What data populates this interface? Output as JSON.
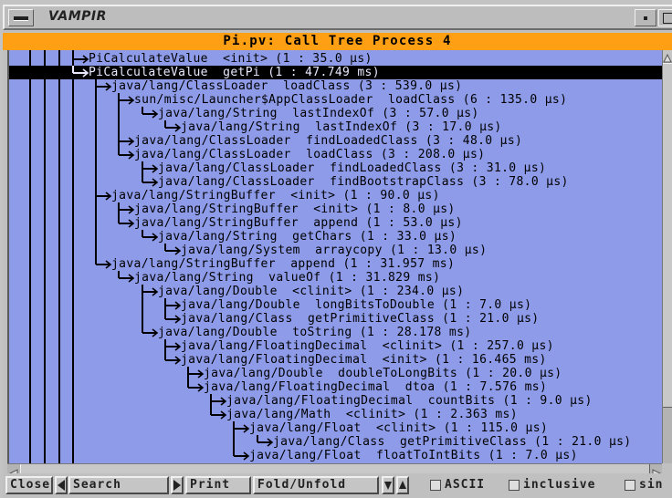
{
  "window": {
    "title": "VAMPIR",
    "colors": {
      "header": "#ff9f14",
      "tree_bg": "#8d9be9",
      "selection": "#000000"
    }
  },
  "tree": {
    "header": "Pi.pv: Call Tree Process 4",
    "rows": [
      {
        "level": 0,
        "text": "PiCalculateValue  <init> (1 : 35.0 µs)",
        "selected": false
      },
      {
        "level": 0,
        "text": "PiCalculateValue  getPi (1 : 47.749 ms)",
        "selected": true
      },
      {
        "level": 1,
        "text": "java/lang/ClassLoader  loadClass (3 : 539.0 µs)",
        "selected": false
      },
      {
        "level": 2,
        "text": "sun/misc/Launcher$AppClassLoader  loadClass (6 : 135.0 µs)",
        "selected": false
      },
      {
        "level": 3,
        "text": "java/lang/String  lastIndexOf (3 : 57.0 µs)",
        "selected": false
      },
      {
        "level": 4,
        "text": "java/lang/String  lastIndexOf (3 : 17.0 µs)",
        "selected": false
      },
      {
        "level": 2,
        "text": "java/lang/ClassLoader  findLoadedClass (3 : 48.0 µs)",
        "selected": false
      },
      {
        "level": 2,
        "text": "java/lang/ClassLoader  loadClass (3 : 208.0 µs)",
        "selected": false
      },
      {
        "level": 3,
        "text": "java/lang/ClassLoader  findLoadedClass (3 : 31.0 µs)",
        "selected": false
      },
      {
        "level": 3,
        "text": "java/lang/ClassLoader  findBootstrapClass (3 : 78.0 µs)",
        "selected": false
      },
      {
        "level": 1,
        "text": "java/lang/StringBuffer  <init> (1 : 90.0 µs)",
        "selected": false
      },
      {
        "level": 2,
        "text": "java/lang/StringBuffer  <init> (1 : 8.0 µs)",
        "selected": false
      },
      {
        "level": 2,
        "text": "java/lang/StringBuffer  append (1 : 53.0 µs)",
        "selected": false
      },
      {
        "level": 3,
        "text": "java/lang/String  getChars (1 : 33.0 µs)",
        "selected": false
      },
      {
        "level": 4,
        "text": "java/lang/System  arraycopy (1 : 13.0 µs)",
        "selected": false
      },
      {
        "level": 1,
        "text": "java/lang/StringBuffer  append (1 : 31.957 ms)",
        "selected": false
      },
      {
        "level": 2,
        "text": "java/lang/String  valueOf (1 : 31.829 ms)",
        "selected": false
      },
      {
        "level": 3,
        "text": "java/lang/Double  <clinit> (1 : 234.0 µs)",
        "selected": false
      },
      {
        "level": 4,
        "text": "java/lang/Double  longBitsToDouble (1 : 7.0 µs)",
        "selected": false
      },
      {
        "level": 4,
        "text": "java/lang/Class  getPrimitiveClass (1 : 21.0 µs)",
        "selected": false
      },
      {
        "level": 3,
        "text": "java/lang/Double  toString (1 : 28.178 ms)",
        "selected": false
      },
      {
        "level": 4,
        "text": "java/lang/FloatingDecimal  <clinit> (1 : 257.0 µs)",
        "selected": false
      },
      {
        "level": 4,
        "text": "java/lang/FloatingDecimal  <init> (1 : 16.465 ms)",
        "selected": false
      },
      {
        "level": 5,
        "text": "java/lang/Double  doubleToLongBits (1 : 20.0 µs)",
        "selected": false
      },
      {
        "level": 5,
        "text": "java/lang/FloatingDecimal  dtoa (1 : 7.576 ms)",
        "selected": false
      },
      {
        "level": 6,
        "text": "java/lang/FloatingDecimal  countBits (1 : 9.0 µs)",
        "selected": false
      },
      {
        "level": 6,
        "text": "java/lang/Math  <clinit> (1 : 2.363 ms)",
        "selected": false
      },
      {
        "level": 7,
        "text": "java/lang/Float  <clinit> (1 : 115.0 µs)",
        "selected": false
      },
      {
        "level": 8,
        "text": "java/lang/Class  getPrimitiveClass (1 : 21.0 µs)",
        "selected": false
      },
      {
        "level": 7,
        "text": "java/lang/Float  floatToIntBits (1 : 7.0 µs)",
        "selected": false
      }
    ]
  },
  "toolbar": {
    "close": "Close",
    "search": "Search",
    "print": "Print",
    "fold_unfold": "Fold/Unfold",
    "ascii": "ASCII",
    "inclusive": "inclusive",
    "sin": "sin"
  }
}
